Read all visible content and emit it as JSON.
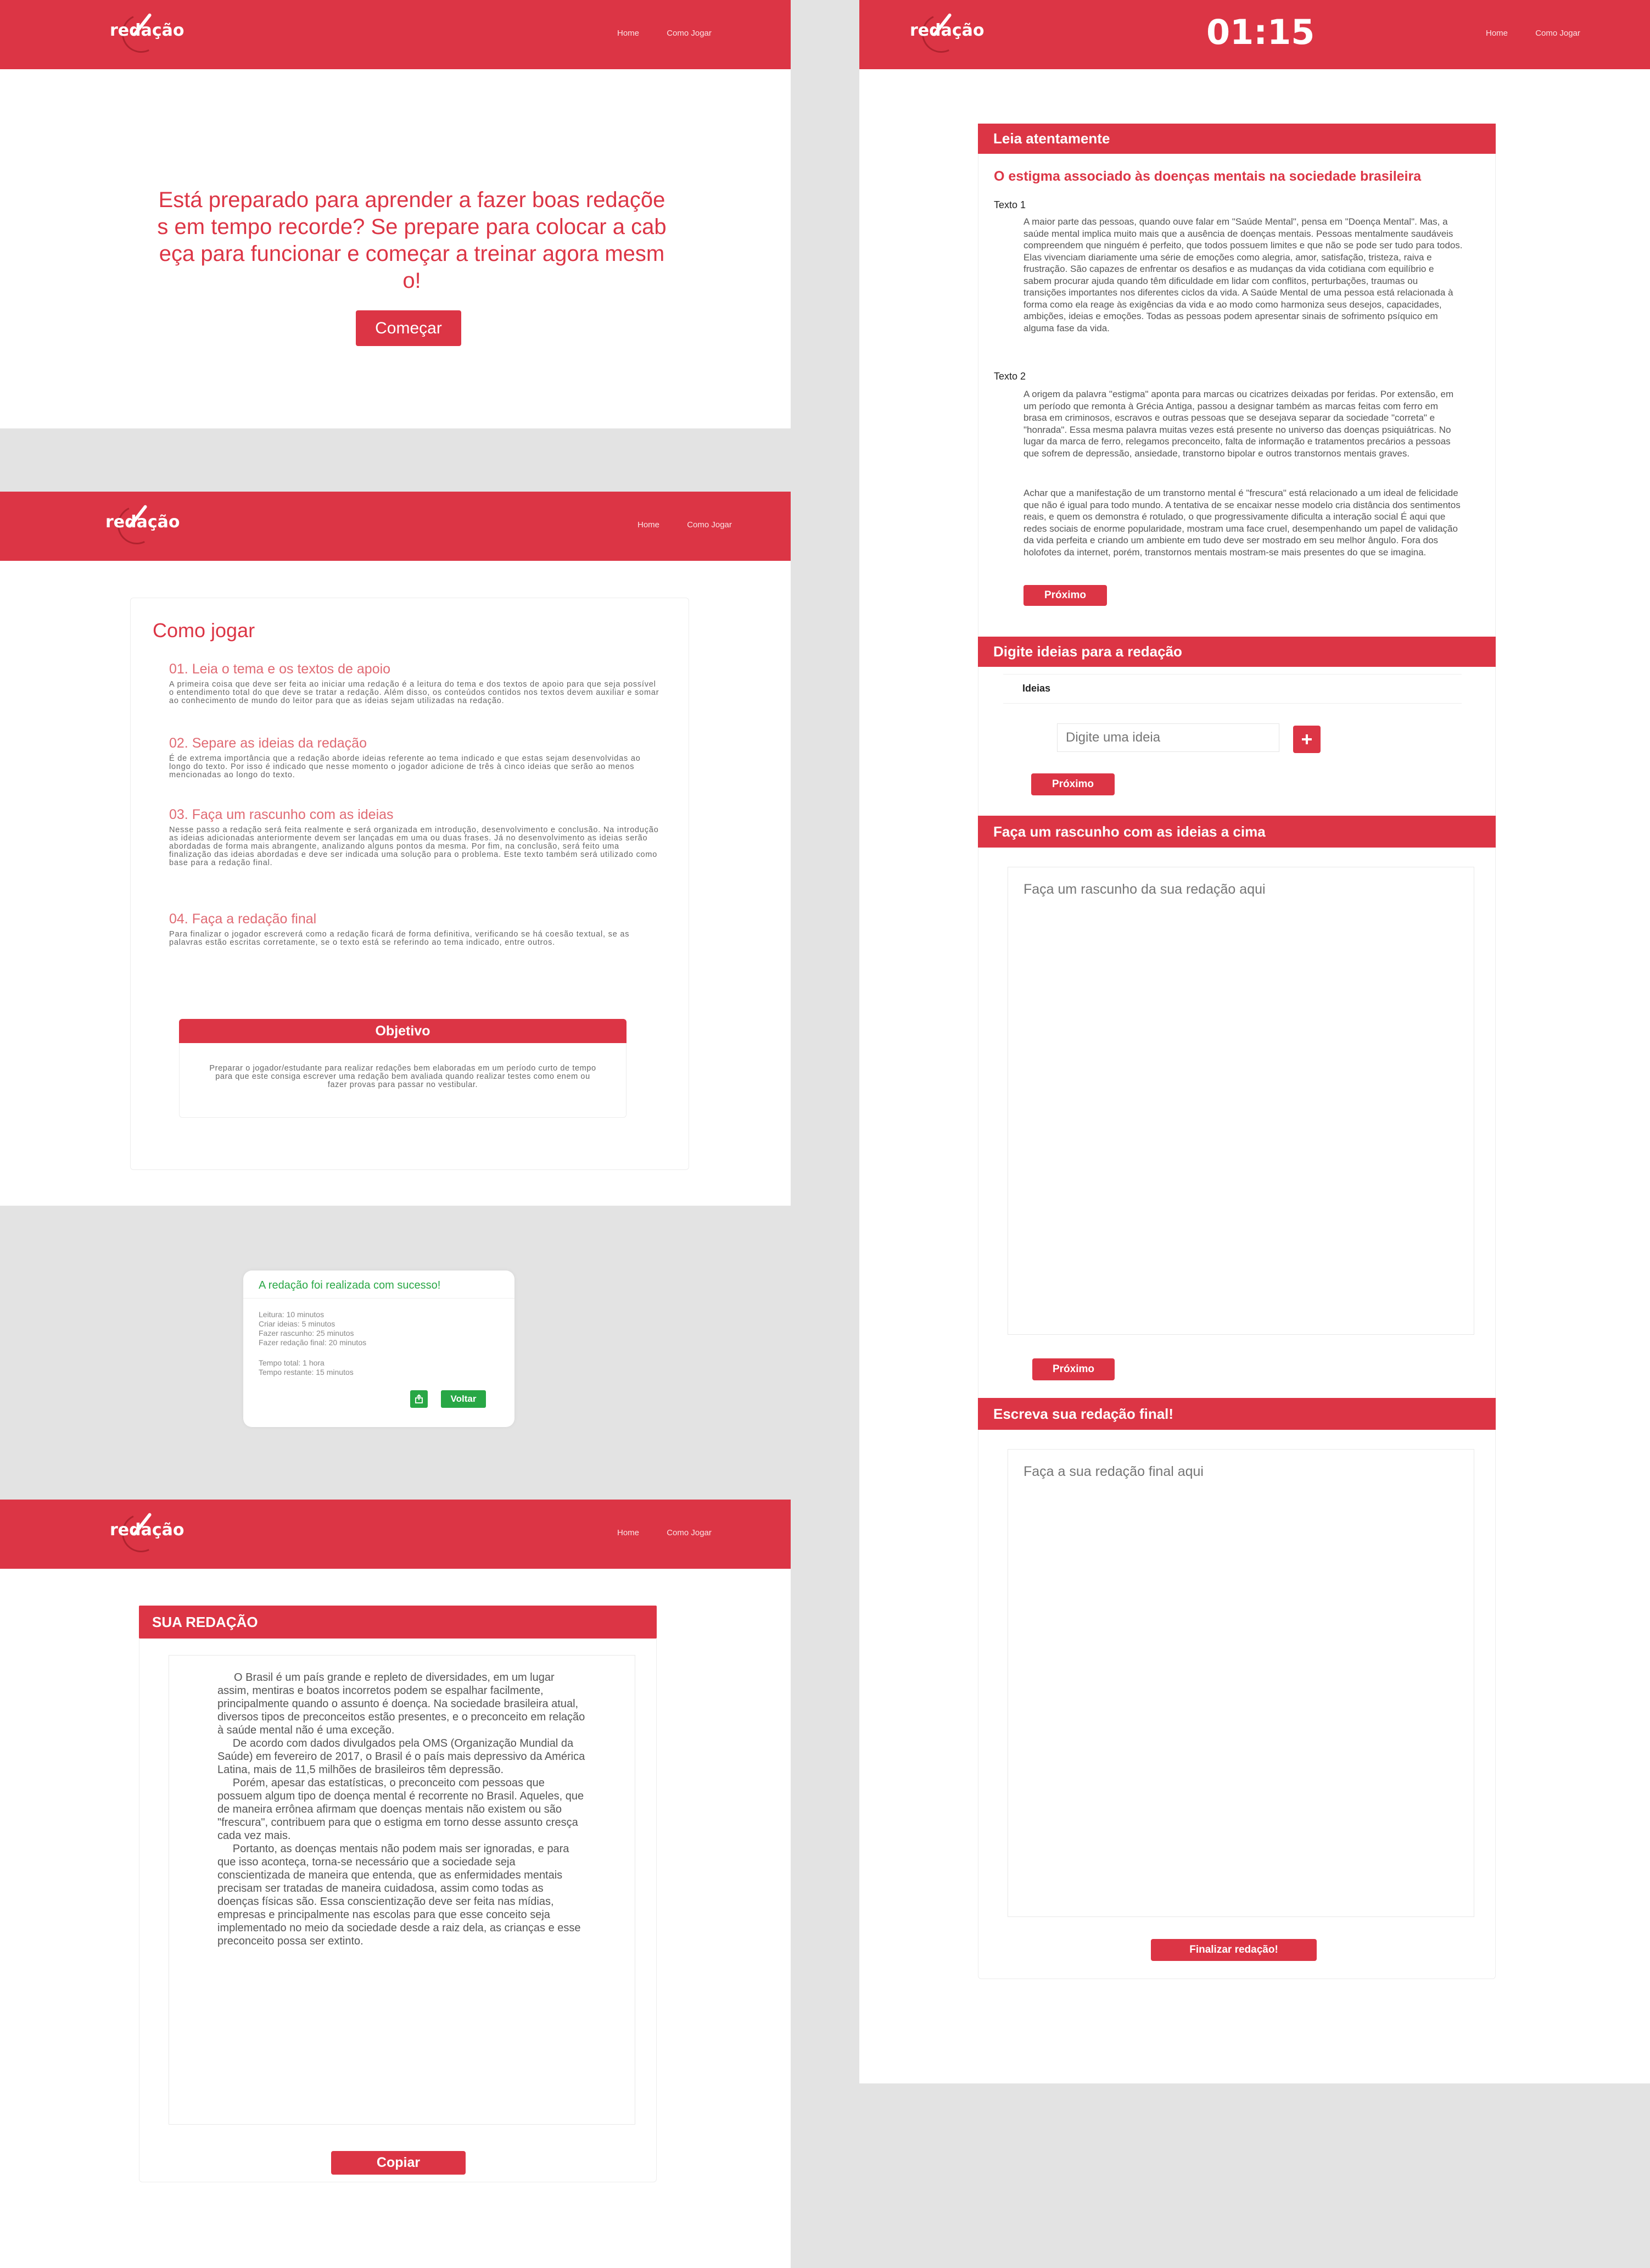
{
  "brand": {
    "logo_text": "redação",
    "primary": "#dc3545",
    "success": "#28a745"
  },
  "nav": {
    "home": "Home",
    "how_to_play": "Como Jogar"
  },
  "landing": {
    "headline": "Está preparado para aprender a fazer boas redações em tempo recorde? Se prepare para colocar a cabeça para funcionar e começar a treinar agora mesmo!",
    "start_button": "Começar"
  },
  "how_to": {
    "title": "Como jogar",
    "steps": [
      {
        "title": "01. Leia o tema e os textos de apoio",
        "body": "A primeira coisa que deve ser feita ao iniciar uma redação é a leitura do tema e dos textos de apoio para que seja possível o entendimento total do que deve se tratar a redação. Além disso, os conteúdos contidos nos textos devem auxiliar e somar ao conhecimento de mundo do leitor para que as ideias sejam utilizadas na redação."
      },
      {
        "title": "02. Separe as ideias da redação",
        "body": "É de extrema importância que a redação aborde ideias referente ao tema indicado e que estas sejam desenvolvidas ao longo do texto. Por isso é indicado que nesse momento o jogador adicione de três à cinco ideias que serão ao menos mencionadas ao longo do texto."
      },
      {
        "title": "03. Faça um rascunho com as ideias",
        "body": "Nesse passo a redação será feita realmente e será organizada em introdução, desenvolvimento e conclusão. Na introdução as ideias adicionadas anteriormente devem ser lançadas em uma ou duas frases. Já no desenvolvimento as ideias serão abordadas de forma mais abrangente, analizando alguns pontos da mesma. Por fim, na conclusão, será feito uma finalização das ideias abordadas e deve ser indicada uma solução para o problema. Este texto também será utilizado como base para a redação final."
      },
      {
        "title": "04. Faça a redação final",
        "body": "Para finalizar o jogador escreverá como a redação ficará de forma definitiva, verificando se há coesão textual, se as palavras estão escritas corretamente, se o texto está se referindo ao tema indicado, entre outros."
      }
    ],
    "objective_title": "Objetivo",
    "objective_body": "Preparar o jogador/estudante para realizar redações bem elaboradas em um período curto de tempo para que este consiga escrever uma redação bem avaliada quando realizar testes como enem ou fazer provas para passar no vestibular."
  },
  "success_modal": {
    "title": "A redação foi realizada com sucesso!",
    "lines_a": [
      "Leitura: 10 minutos",
      "Criar ideias: 5 minutos",
      "Fazer rascunho: 25 minutos",
      "Fazer redação final: 20 minutos"
    ],
    "lines_b": [
      "Tempo total: 1 hora",
      "Tempo restante: 15 minutos"
    ],
    "back_button": "Voltar",
    "share_icon": "share-icon"
  },
  "result": {
    "title": "SUA REDAÇÃO",
    "essay": "O Brasil é um país grande e repleto de diversidades, em um lugar assim, mentiras e boatos incorretos podem se espalhar facilmente, principalmente quando o assunto é doença. Na sociedade brasileira atual, diversos tipos de preconceitos estão presentes, e o preconceito em relação à saúde mental não é uma exceção.\n     De acordo com dados divulgados pela OMS (Organização Mundial da Saúde) em fevereiro de 2017, o Brasil é o país mais depressivo da América Latina, mais de 11,5 milhões de brasileiros têm depressão.\n     Porém, apesar das estatísticas, o preconceito com pessoas que possuem algum tipo de doença mental é recorrente no Brasil. Aqueles, que de maneira errônea afirmam que doenças mentais não existem ou são \"frescura\", contribuem para que o estigma em torno desse assunto cresça cada vez mais.\n     Portanto, as doenças mentais não podem mais ser ignoradas, e para que isso aconteça, torna-se necessário que a sociedade seja conscientizada de maneira que entenda, que as enfermidades mentais precisam ser tratadas de maneira cuidadosa, assim como todas as doenças físicas são. Essa conscientização deve ser feita nas mídias, empresas e principalmente nas escolas para que esse conceito seja implementado no meio da sociedade desde a raiz dela, as crianças e esse preconceito possa ser extinto.",
    "copy_button": "Copiar"
  },
  "game": {
    "timer": "01:15",
    "read_title": "Leia atentamente",
    "theme": "O estigma associado às doenças mentais na sociedade brasileira",
    "text1_label": "Texto 1",
    "text1": "A maior parte das pessoas, quando ouve falar em \"Saúde Mental\", pensa em \"Doença Mental\". Mas, a saúde mental implica muito mais que a ausência de doenças mentais. Pessoas mentalmente saudáveis compreendem que ninguém é perfeito, que todos possuem limites e que não se pode ser tudo para todos. Elas vivenciam diariamente uma série de emoções como alegria, amor, satisfação, tristeza, raiva e frustração. São capazes de enfrentar os desafios e as mudanças da vida cotidiana com equilíbrio e sabem procurar ajuda quando têm dificuldade em lidar com conflitos, perturbações, traumas ou transições importantes nos diferentes ciclos da vida. A Saúde Mental de uma pessoa está relacionada à forma como ela reage às exigências da vida e ao modo como harmoniza seus desejos, capacidades, ambições, ideias e emoções. Todas as pessoas podem apresentar sinais de sofrimento psíquico em alguma fase da vida.",
    "text2_label": "Texto 2",
    "text2a": "A origem da palavra \"estigma\" aponta para marcas ou cicatrizes deixadas por feridas. Por extensão, em um período que remonta à Grécia Antiga, passou a designar também as marcas feitas com ferro em brasa em criminosos, escravos e outras pessoas que se desejava separar da sociedade \"correta\" e \"honrada\". Essa mesma palavra muitas vezes está presente no universo das doenças psiquiátricas. No lugar da marca de ferro, relegamos preconceito, falta de informação e tratamentos precários a pessoas que sofrem de depressão, ansiedade, transtorno bipolar e outros transtornos mentais graves.",
    "text2b": "Achar que a manifestação de um transtorno mental é \"frescura\" está relacionado a um ideal de felicidade que não é igual para todo mundo. A tentativa de se encaixar nesse modelo cria distância dos sentimentos reais, e quem os demonstra é rotulado, o que progressivamente dificulta a interação social É aqui que redes sociais de enorme popularidade, mostram uma face cruel, desempenhando um papel de validação da vida perfeita e criando um ambiente em tudo deve ser mostrado em seu melhor ângulo. Fora dos holofotes da internet, porém, transtornos mentais mostram-se mais presentes do que se imagina.",
    "next_button": "Próximo",
    "ideas_title": "Digite ideias para a redação",
    "ideas_header": "Ideias",
    "idea_placeholder": "Digite uma ideia",
    "draft_title": "Faça um rascunho com as ideias a cima",
    "draft_placeholder": "Faça um rascunho da sua redação aqui",
    "final_title": "Escreva sua redação final!",
    "final_placeholder": "Faça a sua redação final aqui",
    "finish_button": "Finalizar redação!"
  }
}
